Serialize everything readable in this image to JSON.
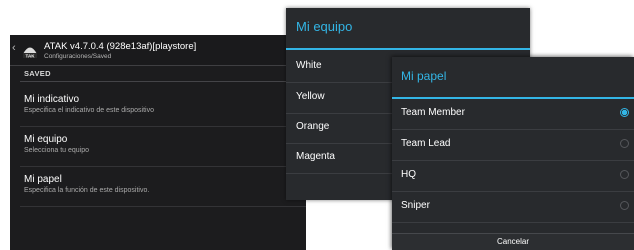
{
  "app_bar": {
    "title": "ATAK v4.7.0.4 (928e13af)[playstore]",
    "subtitle": "Configuraciones/Saved",
    "icon": "tak-app-icon",
    "back_icon": "chevron-left-icon"
  },
  "settings": {
    "section_header": "SAVED",
    "items": [
      {
        "title": "Mi indicativo",
        "summary": "Especifica el indicativo de este dispositivo"
      },
      {
        "title": "Mi equipo",
        "summary": "Selecciona tu equipo"
      },
      {
        "title": "Mi papel",
        "summary": "Especifica la función de este dispositivo."
      }
    ]
  },
  "team_dialog": {
    "title": "Mi equipo",
    "options": [
      "White",
      "Yellow",
      "Orange",
      "Magenta"
    ]
  },
  "role_dialog": {
    "title": "Mi papel",
    "options": [
      {
        "label": "Team Member",
        "selected": true
      },
      {
        "label": "Team Lead",
        "selected": false
      },
      {
        "label": "HQ",
        "selected": false
      },
      {
        "label": "Sniper",
        "selected": false
      }
    ],
    "cancel_label": "Cancelar"
  },
  "colors": {
    "accent": "#33b5e5",
    "dialog_bg": "#282a2d",
    "screen_bg": "#1c1c1e"
  }
}
